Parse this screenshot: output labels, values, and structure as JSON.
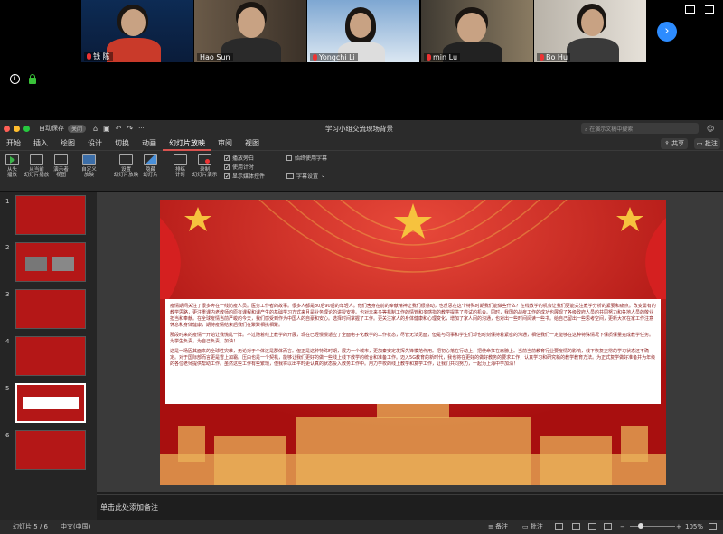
{
  "zoom": {
    "participants": [
      {
        "name": "钱 陈"
      },
      {
        "name": "Hao Sun"
      },
      {
        "name": "Yongchi Li"
      },
      {
        "name": "min Lu"
      },
      {
        "name": "Bo Hu"
      }
    ]
  },
  "ppt": {
    "autosave_label": "自动保存",
    "autosave_state": "关闭",
    "doc_title": "学习小组交流现场背景",
    "search_placeholder": "在演示文稿中搜索",
    "tabs": [
      "开始",
      "插入",
      "绘图",
      "设计",
      "切换",
      "动画",
      "幻灯片放映",
      "审阅",
      "视图"
    ],
    "active_tab": "幻灯片放映",
    "share_label": "共享",
    "comments_label": "批注",
    "ribbon": {
      "buttons": [
        {
          "label": "从头\n播放"
        },
        {
          "label": "从当前\n幻灯片播放"
        },
        {
          "label": "演示者\n视图"
        },
        {
          "label": "自定义\n放映"
        },
        {
          "label": "设置\n幻灯片放映"
        },
        {
          "label": "隐藏\n幻灯片"
        },
        {
          "label": "排练\n计时"
        },
        {
          "label": "录制\n幻灯片演示"
        }
      ],
      "checks": [
        {
          "label": "播放旁白",
          "checked": true
        },
        {
          "label": "使用计时",
          "checked": true
        },
        {
          "label": "显示媒体控件",
          "checked": true
        }
      ],
      "subtitle_check": "始终使用字幕",
      "subtitle_settings": "字幕设置"
    },
    "slide_text": {
      "p1": "疫情期间关注了很多奔在一线防疫人员。医务工作者的故事。很多人都是80后90后的年轻人。他们舍身在前的奉献精神让我们很感动，也反思在这个特殊时期我们能做些什么？在线教学的机会让我们更能关注教学分析的紧要和痛点。改变需有的教学思路，更注重课内老教师的原有课程和课产生的基础学习方式来且是业务理论的讲授安排。也对未来多等机制工作的情管和多感指的教学提供了尝试的机会。同时，我国的战疫工作的成功也展现了各级政府人员的共同努力和各地人员的敬业担当和奉献。在全球疫情当前严峻的今天，我们感受到作为中国人的自豪和安心。选择时间掌握了工作。更关注家人的身体健康和心理变化，增加了家人间的沟通，也对出一些时间阅读一些书。给自己留出一些思考空间，更新大家在家工作注意休息和身体健康，期待疫情结束后我们在聚聚相携相聚。",
      "p2": "那段时来的疫情一开始让我慌乱一阵。不过随着线上教学的开展，现在已经慢慢适应了全面电子化教学的工作状态，尽管无法见面，但是与同事和学生们却也时刻保持着紧密的沟通，相信我们一定能够在这种特殊情况下保质保量完成教学任务。为学生负责，为自己负责，加油！",
      "p3": "这是一场因其面来的全球性灾难，无论对于个体还是群体而言。但正是这种特殊时期，展力一个城市，更加秦安定发挥先锋模范作用。把初心落在行动上，把使命扛在肩膀上。当前当前教育行业要疫情的影响，线下恢复正常的学习状态还不确定。对于国际部而言更是雪上加霜。压由也是一个契机，能够让我们更好的做一些线上线下教学的统合和准备工作。迈入5G教育的新时代，我也将在更好的做好教务的要求工作，认真学习和研究新的教学教育方法。为正式复学做好准备并为年级的各位老师提供帮助工作。虽然这些工作有些繁琐，但我将以出平时更认真的状态投入教务工作中。用力学校的线上教学和复学工作，让我们共同努力，一起为上海中学加油！"
    },
    "slide_count": 6,
    "active_slide": 5,
    "notes_placeholder": "单击此处添加备注",
    "status": {
      "slide_indicator": "幻灯片 5 / 6",
      "language": "中文(中国)",
      "notes_btn": "备注",
      "comments_btn": "批注",
      "zoom": "105%"
    }
  }
}
